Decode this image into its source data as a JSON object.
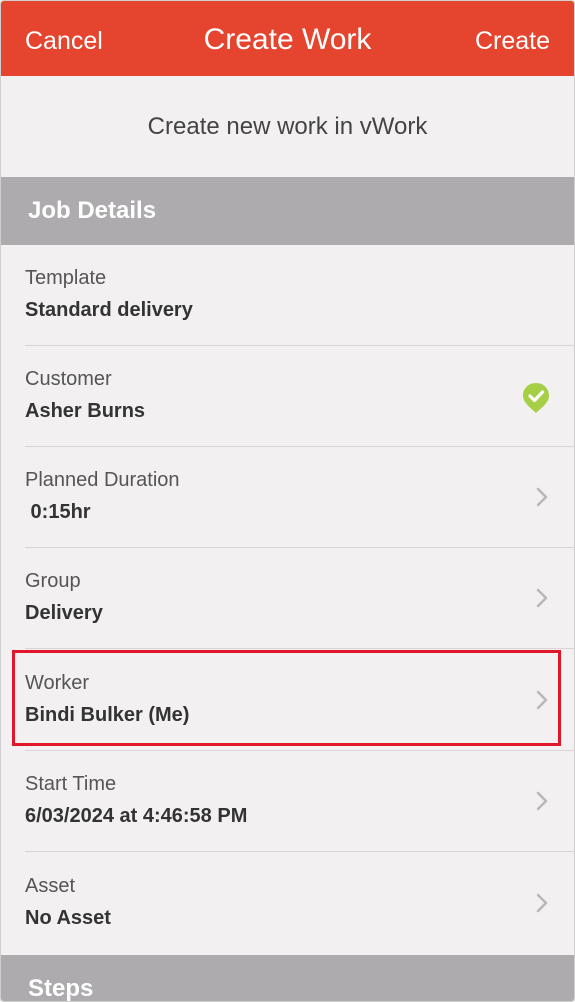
{
  "navbar": {
    "cancel_label": "Cancel",
    "title": "Create Work",
    "create_label": "Create"
  },
  "intro_text": "Create new work in vWork",
  "sections": {
    "job_details": "Job Details",
    "steps": "Steps"
  },
  "fields": [
    {
      "label": "Template",
      "value": "Standard delivery",
      "accessory": "none"
    },
    {
      "label": "Customer",
      "value": "Asher Burns",
      "accessory": "check-icon"
    },
    {
      "label": "Planned Duration",
      "value": " 0:15hr",
      "accessory": "chevron-right-icon"
    },
    {
      "label": "Group",
      "value": "Delivery",
      "accessory": "chevron-right-icon"
    },
    {
      "label": "Worker",
      "value": "Bindi Bulker (Me)",
      "accessory": "chevron-right-icon"
    },
    {
      "label": "Start Time",
      "value": "6/03/2024 at 4:46:58 PM",
      "accessory": "chevron-right-icon"
    },
    {
      "label": "Asset",
      "value": "No Asset",
      "accessory": "chevron-right-icon"
    }
  ],
  "colors": {
    "navbar": "#e5452f",
    "section_header": "#adabae",
    "check": "#a6cf45",
    "highlight": "#e0162b"
  }
}
